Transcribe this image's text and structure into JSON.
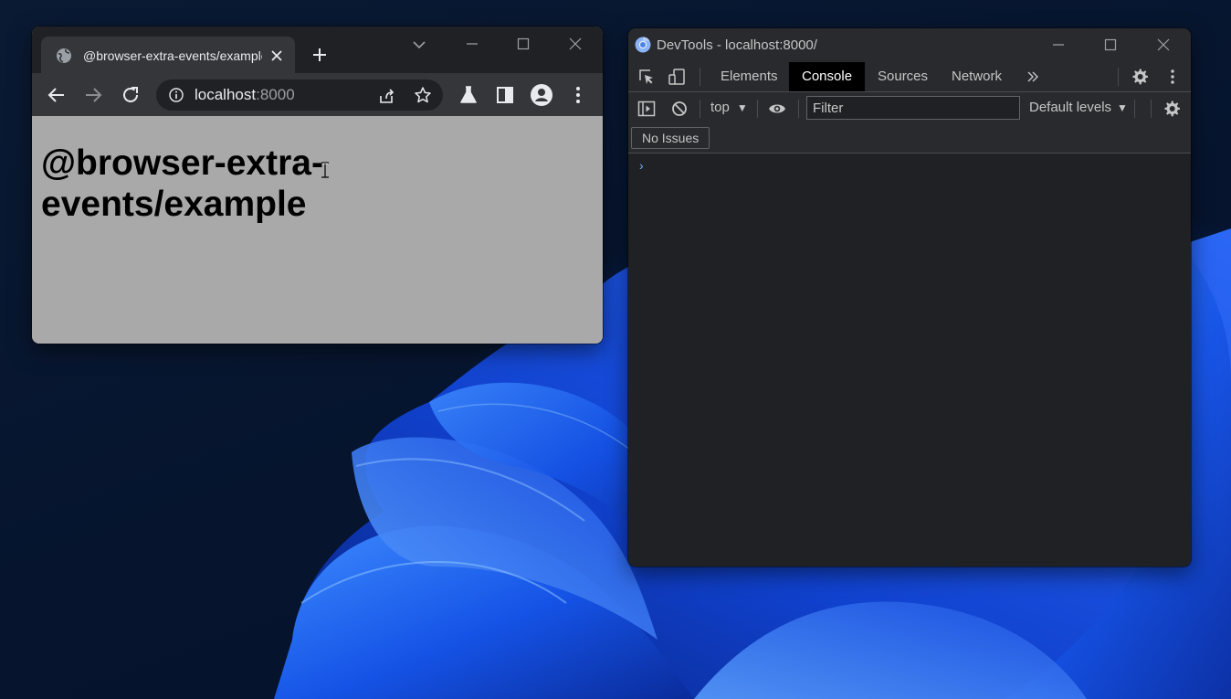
{
  "browser": {
    "tab": {
      "title": "@browser-extra-events/example",
      "favicon_icon": "globe-icon"
    },
    "address": {
      "host": "localhost",
      "port": ":8000"
    },
    "page": {
      "heading": "@browser-extra-events/example"
    }
  },
  "devtools": {
    "window_title": "DevTools - localhost:8000/",
    "tabs": [
      {
        "label": "Elements",
        "active": false
      },
      {
        "label": "Console",
        "active": true
      },
      {
        "label": "Sources",
        "active": false
      },
      {
        "label": "Network",
        "active": false
      }
    ],
    "console": {
      "context": "top",
      "filter_placeholder": "Filter",
      "levels": "Default levels",
      "issues": "No Issues",
      "prompt": "›"
    }
  },
  "colors": {
    "accent": "#7cacf8",
    "page_background": "#a9a9a9",
    "devtools_background": "#202124"
  }
}
